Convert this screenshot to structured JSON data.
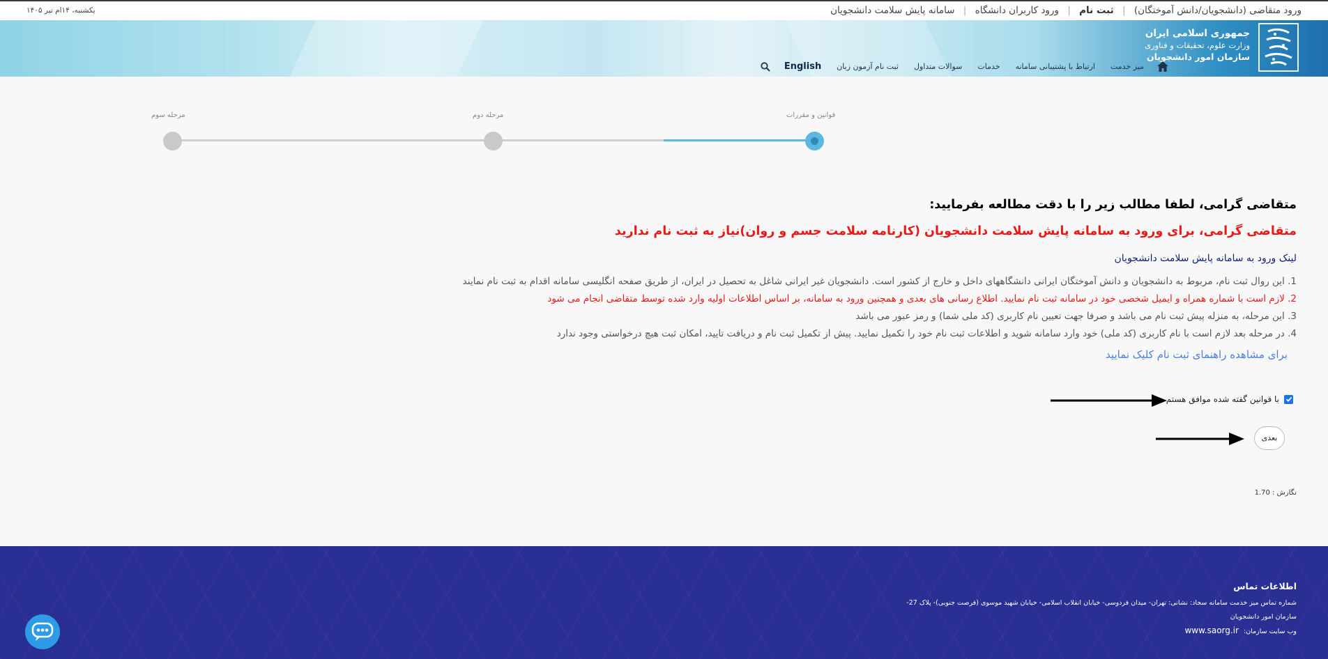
{
  "topbar": {
    "link_applicant": "ورود متقاضی (دانشجویان/دانش آموختگان)",
    "link_register": "ثبت نام",
    "link_university": "ورود کاربران دانشگاه",
    "link_health": "سامانه پایش سلامت دانشجویان",
    "date": "یکشنبه، ۱۴ام تیر ۱۴۰۵"
  },
  "header": {
    "logo_line1": "جمهوری اسلامی ایران",
    "logo_line2": "وزارت علوم، تحقیقات و فناوری",
    "logo_line3": "سازمان امور دانشجویان",
    "logo_mark": "امور دانشجویان",
    "nav": {
      "service_desk": "میز خدمت",
      "support": "ارتباط با پشتیبانی سامانه",
      "services": "خدمات",
      "faq": "سوالات متداول",
      "language_test": "ثبت نام آزمون زبان",
      "english": "English"
    }
  },
  "stepper": {
    "step1": "قوانین و مقررات",
    "step2": "مرحله دوم",
    "step3": "مرحله سوم",
    "progress": 0.5
  },
  "content": {
    "heading": "متقاضی گرامی، لطفا مطالب زیر را با دقت مطالعه بفرمایید:",
    "notice": "متقاضی گرامی، برای ورود به سامانه پایش سلامت دانشجویان (کارنامه سلامت جسم و روان)نیاز به ثبت نام ندارید",
    "health_link": "لینک ورود به سامانه پایش سلامت دانشجویان",
    "rules": [
      "1. این روال ثبت نام، مربوط به دانشجویان و دانش آموختگان ایرانی دانشگاههای داخل و خارج از کشور است. دانشجویان غیر ایرانی شاغل به تحصیل در ایران، از طریق صفحه انگلیسی سامانه اقدام به ثبت نام نمایند",
      "2. لازم است با شماره همراه و ایمیل شخصی خود در سامانه ثبت نام نمایید. اطلاع رسانی های بعدی و همچنین ورود به سامانه، بر اساس اطلاعات اولیه وارد شده توسط متقاضی انجام می شود",
      "3. این مرحله، به منزله پیش ثبت نام می باشد و صرفا جهت تعیین نام کاربری (کد ملی شما) و رمز عبور می باشد",
      "4. در مرحله بعد لازم است با نام کاربری (کد ملی) خود وارد سامانه شوید و اطلاعات ثبت نام خود را تکمیل نمایید. پیش از تکمیل ثبت نام و دریافت تایید، امکان ثبت هیچ درخواستی وجود ندارد"
    ],
    "guide_link": "برای مشاهده راهنمای ثبت نام کلیک نمایید",
    "agree_label": "با قوانین گفته شده موافق هستم",
    "agree_checked": true,
    "next_button": "بعدی",
    "version": "نگارش : 1.70"
  },
  "footer": {
    "title": "اطلاعات تماس",
    "line1": "شماره تماس میز خدمت سامانه سجاد: نشانی: تهران- میدان فردوسی- خیابان انقلاب اسلامی- خیابان شهید موسوی (فرصت جنوبی)- پلاک 27-",
    "line2": "سازمان امور دانشجویان",
    "website_label": "وب سایت سازمان:",
    "website": "www.saorg.ir"
  },
  "colors": {
    "accent": "#5bb8e0",
    "notice_red": "#e81919",
    "footer_bg": "#2a2f93",
    "chat_button": "#2f9be6"
  }
}
